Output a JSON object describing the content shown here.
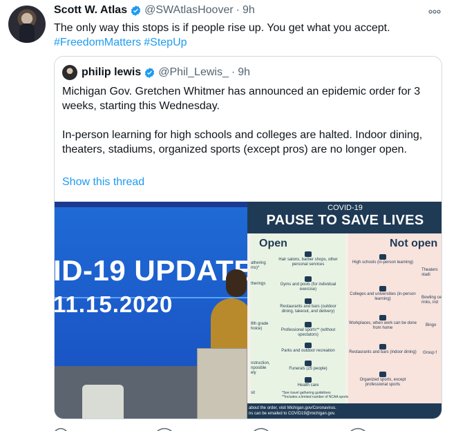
{
  "tweet": {
    "name": "Scott W. Atlas",
    "handle": "@SWAtlasHoover",
    "separator": "·",
    "time": "9h",
    "text": "The only way this stops is if people rise up. You get what you accept.",
    "hashtags": [
      "#FreedomMatters",
      "#StepUp"
    ],
    "more_icon": "more-icon"
  },
  "quote": {
    "name": "philip lewis",
    "handle": "@Phil_Lewis_",
    "separator": "·",
    "time": "9h",
    "paragraphs": [
      "Michigan Gov. Gretchen Whitmer has announced an epidemic order for 3 weeks, starting this Wednesday.",
      "In-person learning for high schools and colleges are halted. Indoor dining, theaters, stadiums, organized sports (except pros) are no longer open."
    ],
    "show_thread": "Show this thread"
  },
  "media": {
    "left": {
      "title": "ID-19 UPDATE",
      "date": "11.15.2020"
    },
    "right": {
      "header_small": "COVID-19",
      "header_big": "PAUSE TO SAVE LIVES",
      "open_title": "Open",
      "not_open_title": "Not open",
      "open_side": [
        "athering\nms)*",
        "therings",
        "8th grade\nhoice)",
        "nstruction,\nnposible\nely",
        "sit"
      ],
      "open_items": [
        "Hair salons, barber shops, other personal services",
        "Gyms and pools (for individual exercise)",
        "Restaurants and bars (outdoor dining, takeout, and delivery)",
        "Professional sports** (without spectators)",
        "Parks and outdoor recreation",
        "Funerals (25 people)",
        "Health care"
      ],
      "open_footnote": "*See travel gathering guidelines\n**Includes a limited number of NCAA sports",
      "not_open_items": [
        "High schools (in-person learning)",
        "Colleges and universities (in-person learning)",
        "Workplaces, when work can be done from home",
        "Restaurants and bars (indoor dining)",
        "Organized sports, except professional sports"
      ],
      "not_open_side": [
        "Theaters\nstadi",
        "Bowling ce\nrinks, ind",
        "Bingo",
        "Group f"
      ],
      "footer": "about the order, visit Michigan.gov/Coronavirus.\nns can be emailed to COVID19@michigan.gov."
    }
  },
  "colors": {
    "link": "#1d9bf0",
    "secondary": "#536471",
    "verified": "#1d9bf0",
    "border": "#cfd9de"
  }
}
